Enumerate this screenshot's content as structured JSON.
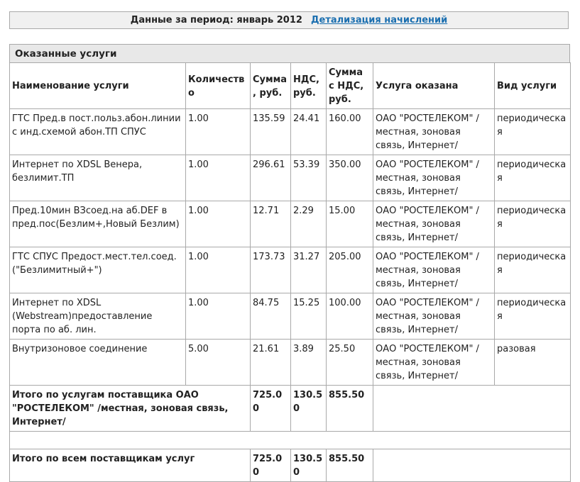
{
  "period": {
    "label": "Данные за период: январь 2012",
    "details_link": "Детализация начислений"
  },
  "section": {
    "title": "Оказанные услуги",
    "columns": [
      "Наименование услуги",
      "Количество",
      "Сумма, руб.",
      "НДС, руб.",
      "Сумма с НДС, руб.",
      "Услуга оказана",
      "Вид услуги"
    ],
    "rows": [
      {
        "name": "ГТС Пред.в пост.польз.абон.линии с инд.схемой абон.ТП СПУС",
        "qty": "1.00",
        "sum": "135.59",
        "vat": "24.41",
        "total": "160.00",
        "provider": "ОАО \"РОСТЕЛЕКОМ\" /местная, зоновая связь, Интернет/",
        "kind": "периодическая"
      },
      {
        "name": "Интернет по XDSL Венера, безлимит.ТП",
        "qty": "1.00",
        "sum": "296.61",
        "vat": "53.39",
        "total": "350.00",
        "provider": "ОАО \"РОСТЕЛЕКОМ\" /местная, зоновая связь, Интернет/",
        "kind": "периодическая"
      },
      {
        "name": "Пред.10мин ВЗсоед.на аб.DEF в пред.пос(Безлим+,Новый Безлим)",
        "qty": "1.00",
        "sum": "12.71",
        "vat": "2.29",
        "total": "15.00",
        "provider": "ОАО \"РОСТЕЛЕКОМ\" /местная, зоновая связь, Интернет/",
        "kind": "периодическая"
      },
      {
        "name": "ГТС СПУС Предост.мест.тел.соед. (\"Безлимитный+\")",
        "qty": "1.00",
        "sum": "173.73",
        "vat": "31.27",
        "total": "205.00",
        "provider": "ОАО \"РОСТЕЛЕКОМ\" /местная, зоновая связь, Интернет/",
        "kind": "периодическая"
      },
      {
        "name": "Интернет по XDSL (Webstream)предоставление порта по аб. лин.",
        "qty": "1.00",
        "sum": "84.75",
        "vat": "15.25",
        "total": "100.00",
        "provider": "ОАО \"РОСТЕЛЕКОМ\" /местная, зоновая связь, Интернет/",
        "kind": "периодическая"
      },
      {
        "name": "Внутризоновое соединение",
        "qty": "5.00",
        "sum": "21.61",
        "vat": "3.89",
        "total": "25.50",
        "provider": "ОАО \"РОСТЕЛЕКОМ\" /местная, зоновая связь, Интернет/",
        "kind": "разовая"
      }
    ],
    "provider_total": {
      "label": "Итого по услугам поставщика ОАО \"РОСТЕЛЕКОМ\" /местная, зоновая связь, Интернет/",
      "sum": "725.00",
      "vat": "130.50",
      "total": "855.50"
    },
    "grand_total": {
      "label": "Итого по всем поставщикам услуг",
      "sum": "725.00",
      "vat": "130.50",
      "total": "855.50"
    }
  }
}
